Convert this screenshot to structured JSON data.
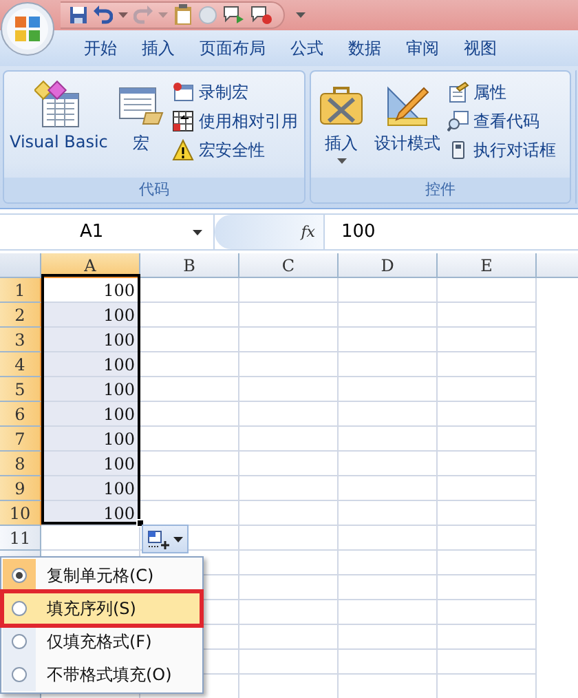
{
  "tabs": [
    {
      "label": "开始"
    },
    {
      "label": "插入"
    },
    {
      "label": "页面布局"
    },
    {
      "label": "公式"
    },
    {
      "label": "数据"
    },
    {
      "label": "审阅"
    },
    {
      "label": "视图"
    }
  ],
  "ribbon_groups": [
    {
      "label": "代码",
      "large_buttons": [
        {
          "label": "Visual Basic",
          "kind": "vb",
          "dropdown": false
        },
        {
          "label": "宏",
          "kind": "macro",
          "dropdown": false
        }
      ],
      "small_buttons": [
        {
          "label": "录制宏",
          "kind": "record"
        },
        {
          "label": "使用相对引用",
          "kind": "relative"
        },
        {
          "label": "宏安全性",
          "kind": "warning"
        }
      ]
    },
    {
      "label": "控件",
      "large_buttons": [
        {
          "label": "插入",
          "kind": "tools",
          "dropdown": true
        },
        {
          "label": "设计模式",
          "kind": "design",
          "dropdown": false
        }
      ],
      "small_buttons": [
        {
          "label": "属性",
          "kind": "properties"
        },
        {
          "label": "查看代码",
          "kind": "viewcode"
        },
        {
          "label": "执行对话框",
          "kind": "dialog"
        }
      ]
    }
  ],
  "formula_bar": {
    "name_box": "A1",
    "fx_label": "fx",
    "value": "100"
  },
  "columns": [
    {
      "label": "A",
      "selected": true
    },
    {
      "label": "B",
      "selected": false
    },
    {
      "label": "C",
      "selected": false
    },
    {
      "label": "D",
      "selected": false
    },
    {
      "label": "E",
      "selected": false
    }
  ],
  "rows": [
    {
      "label": "1",
      "selected": true,
      "cells": [
        {
          "value": "100",
          "active": true
        }
      ]
    },
    {
      "label": "2",
      "selected": true,
      "cells": [
        {
          "value": "100",
          "active": false
        }
      ]
    },
    {
      "label": "3",
      "selected": true,
      "cells": [
        {
          "value": "100",
          "active": false
        }
      ]
    },
    {
      "label": "4",
      "selected": true,
      "cells": [
        {
          "value": "100",
          "active": false
        }
      ]
    },
    {
      "label": "5",
      "selected": true,
      "cells": [
        {
          "value": "100",
          "active": false
        }
      ]
    },
    {
      "label": "6",
      "selected": true,
      "cells": [
        {
          "value": "100",
          "active": false
        }
      ]
    },
    {
      "label": "7",
      "selected": true,
      "cells": [
        {
          "value": "100",
          "active": false
        }
      ]
    },
    {
      "label": "8",
      "selected": true,
      "cells": [
        {
          "value": "100",
          "active": false
        }
      ]
    },
    {
      "label": "9",
      "selected": true,
      "cells": [
        {
          "value": "100",
          "active": false
        }
      ]
    },
    {
      "label": "10",
      "selected": true,
      "cells": [
        {
          "value": "100",
          "active": false
        }
      ]
    },
    {
      "label": "11",
      "selected": false,
      "cells": []
    }
  ],
  "autofill_menu": {
    "items": [
      {
        "label": "复制单元格(C)",
        "selected": true,
        "highlighted": false
      },
      {
        "label": "填充序列(S)",
        "selected": false,
        "highlighted": true
      },
      {
        "label": "仅填充格式(F)",
        "selected": false,
        "highlighted": false
      },
      {
        "label": "不带格式填充(O)",
        "selected": false,
        "highlighted": false
      }
    ]
  }
}
